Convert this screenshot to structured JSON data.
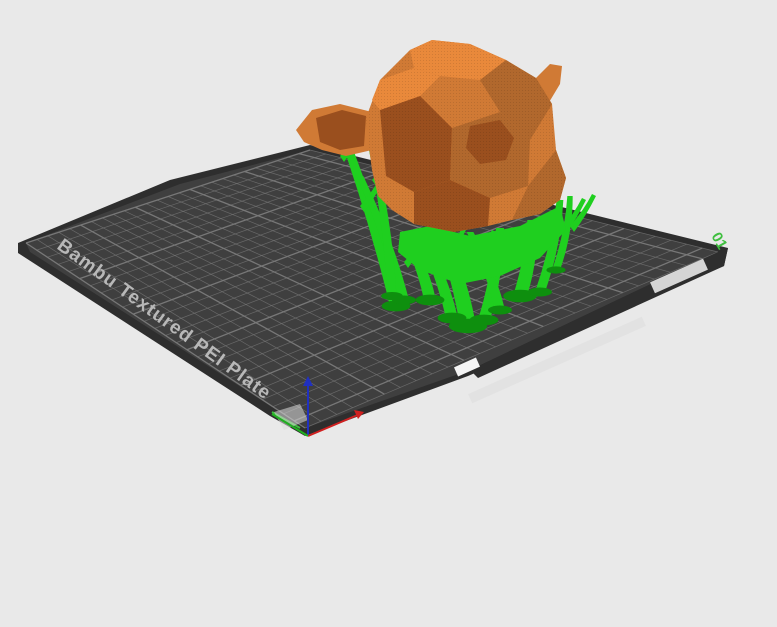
{
  "viewport": {
    "background_color": "#e9e9e9"
  },
  "build_plate": {
    "label": "Bambu Textured PEI Plate",
    "plate_number": "01",
    "surface_color": "#3f3f3f",
    "frame_color": "#2e2e2e",
    "grid_color": "#7a7a7a",
    "edge_accent_color": "#3fbf3f"
  },
  "model": {
    "name": "Suzanne",
    "color": "#d07a35",
    "shadow_color": "#9a4f1e"
  },
  "supports": {
    "color": "#1fcf1f",
    "shadow_color": "#0e8f0e"
  },
  "axes": {
    "x_color": "#d02020",
    "y_color": "#20b020",
    "z_color": "#2030c0"
  }
}
